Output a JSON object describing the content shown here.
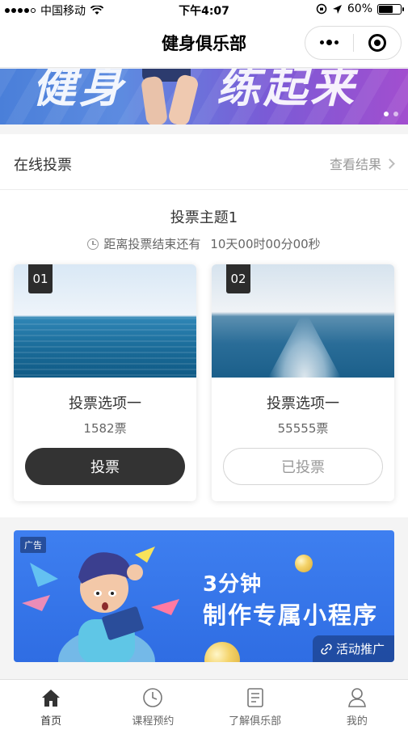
{
  "status_bar": {
    "carrier": "中国移动",
    "time": "下午4:07",
    "battery": "60%"
  },
  "navbar": {
    "title": "健身俱乐部"
  },
  "banner": {
    "text_left": "健身",
    "text_right": "练起来"
  },
  "vote": {
    "section_label": "在线投票",
    "view_results": "查看结果",
    "topic": "投票主题1",
    "countdown_label": "距离投票结束还有",
    "countdown_value": "10天00时00分00秒",
    "options": [
      {
        "number": "01",
        "label": "投票选项一",
        "count": "1582票",
        "button": "投票"
      },
      {
        "number": "02",
        "label": "投票选项一",
        "count": "55555票",
        "button": "已投票"
      }
    ]
  },
  "ad": {
    "tag": "广告",
    "line1": "3分钟",
    "line2": "制作专属小程序",
    "promo": "活动推广"
  },
  "tabbar": {
    "items": [
      {
        "label": "首页",
        "icon": "home-icon"
      },
      {
        "label": "课程预约",
        "icon": "clock-icon"
      },
      {
        "label": "了解俱乐部",
        "icon": "document-icon"
      },
      {
        "label": "我的",
        "icon": "user-icon"
      }
    ]
  }
}
